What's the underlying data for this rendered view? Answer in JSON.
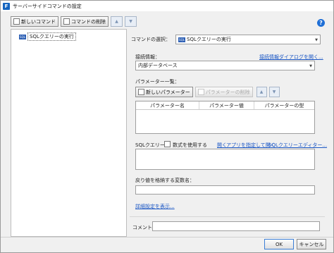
{
  "window": {
    "title": "サーバーサイドコマンドの設定",
    "app_icon_letter": "F"
  },
  "toolbar": {
    "new_command": "新しいコマンド",
    "delete_command": "コマンドの削除"
  },
  "tree": {
    "node_label": "SQLクエリーの実行",
    "node_icon": "SQL"
  },
  "command_select": {
    "label": "コマンドの選択：",
    "value": "SQLクエリーの実行",
    "icon": "SQL"
  },
  "connection": {
    "label": "接続情報：",
    "link": "接続情報ダイアログを開く...",
    "value": "内部データベース"
  },
  "parameters": {
    "label": "パラメーター一覧：",
    "new_label": "新しいパラメーター",
    "delete_label": "パラメーターの削除",
    "columns": [
      "パラメーター名",
      "パラメーター値",
      "パラメーターの型"
    ]
  },
  "sql": {
    "label": "SQLクエリー",
    "formula_label": "数式を使用する",
    "open_link": "開く",
    "open_app_link": "アプリを指定して開く",
    "editor_link": "SQLクエリーエディター..."
  },
  "return_var": {
    "label": "戻り値を格納する変数名：",
    "value": ""
  },
  "advanced_link": "詳細設定を表示...",
  "comment": {
    "label": "コメント",
    "value": ""
  },
  "footer": {
    "ok": "OK",
    "cancel": "キャンセル"
  },
  "colors": {
    "accent": "#1a56c4",
    "title_icon": "#1565c0",
    "help": "#1f6fd6"
  }
}
